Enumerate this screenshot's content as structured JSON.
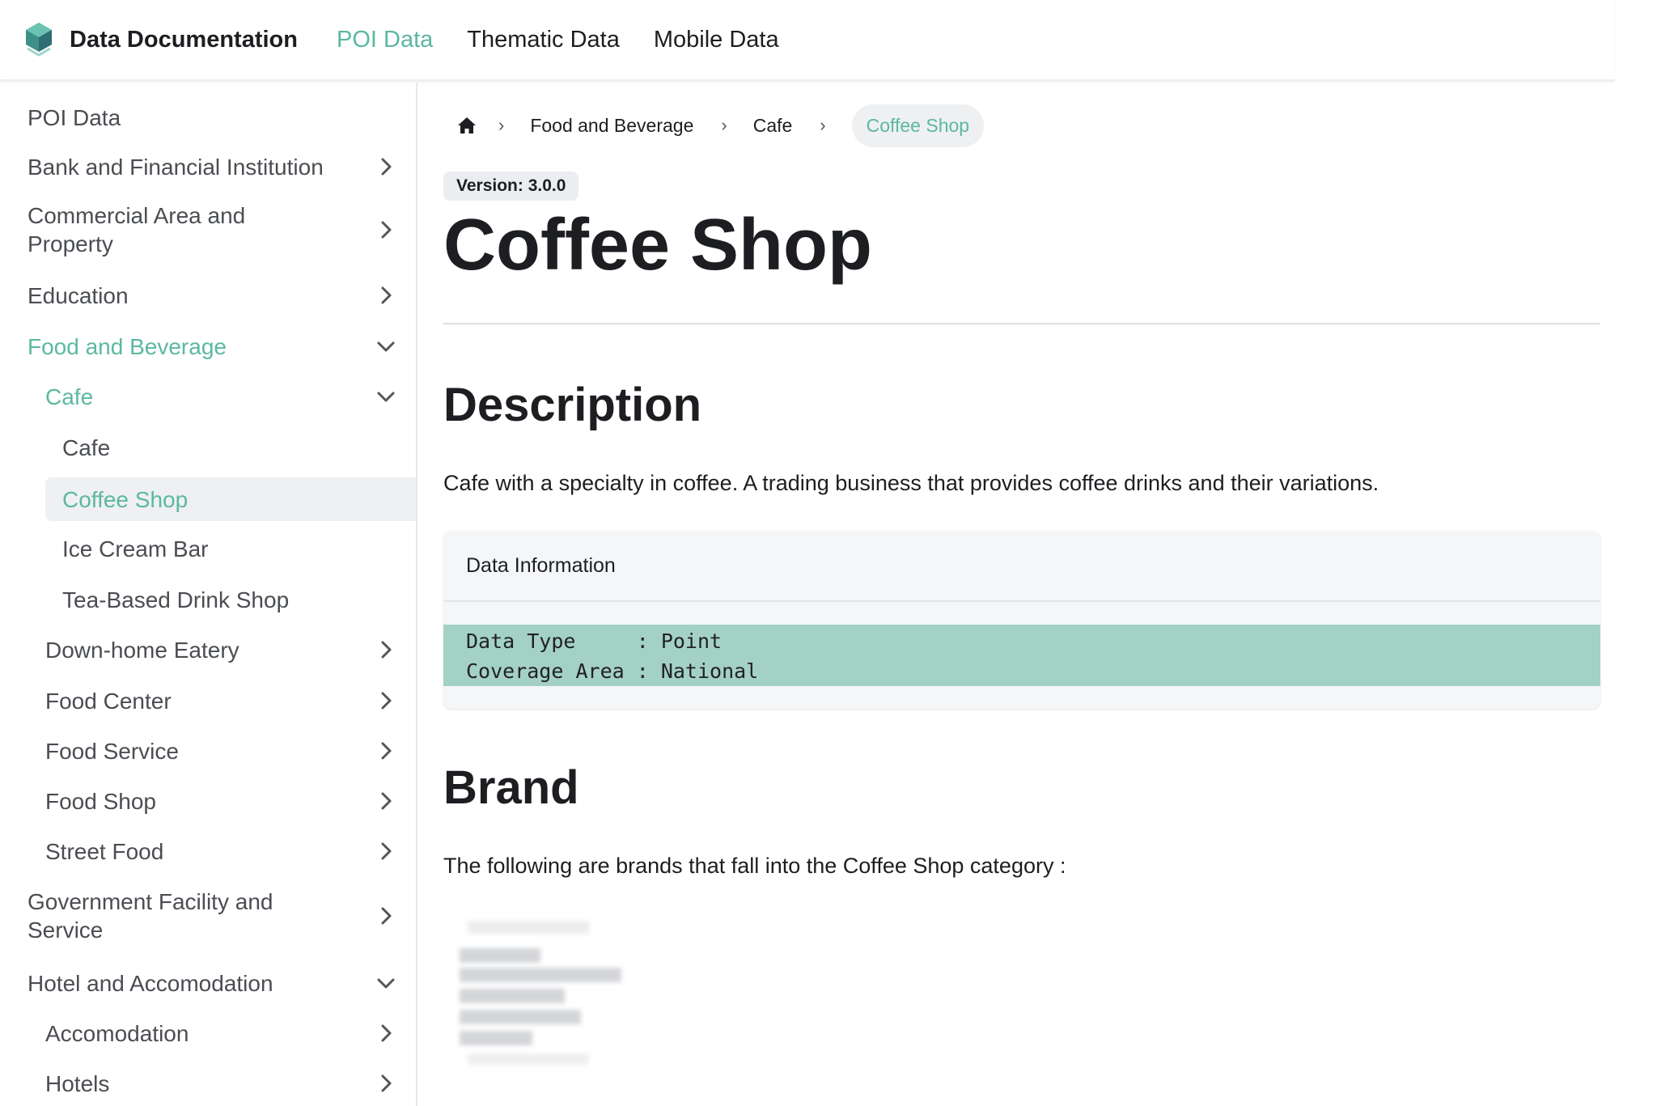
{
  "header": {
    "title": "Data Documentation",
    "nav": [
      {
        "label": "POI Data",
        "active": true
      },
      {
        "label": "Thematic Data",
        "active": false
      },
      {
        "label": "Mobile Data",
        "active": false
      }
    ]
  },
  "sidebar": {
    "items": [
      {
        "label": "POI Data",
        "chevron": "none"
      },
      {
        "label": "Bank and Financial Institution",
        "chevron": "right"
      },
      {
        "label": "Commercial Area and Property",
        "chevron": "right"
      },
      {
        "label": "Education",
        "chevron": "right"
      },
      {
        "label": "Food and Beverage",
        "chevron": "down"
      },
      {
        "label": "Cafe",
        "chevron": "down"
      },
      {
        "label": "Cafe",
        "chevron": "none"
      },
      {
        "label": "Coffee Shop",
        "chevron": "none"
      },
      {
        "label": "Ice Cream Bar",
        "chevron": "none"
      },
      {
        "label": "Tea-Based Drink Shop",
        "chevron": "none"
      },
      {
        "label": "Down-home Eatery",
        "chevron": "right"
      },
      {
        "label": "Food Center",
        "chevron": "right"
      },
      {
        "label": "Food Service",
        "chevron": "right"
      },
      {
        "label": "Food Shop",
        "chevron": "right"
      },
      {
        "label": "Street Food",
        "chevron": "right"
      },
      {
        "label": "Government Facility and Service",
        "chevron": "right"
      },
      {
        "label": "Hotel and Accomodation",
        "chevron": "down"
      },
      {
        "label": "Accomodation",
        "chevron": "right"
      },
      {
        "label": "Hotels",
        "chevron": "right"
      }
    ]
  },
  "breadcrumb": {
    "items": [
      "Food and Beverage",
      "Cafe"
    ],
    "current": "Coffee Shop"
  },
  "page": {
    "version": "Version: 3.0.0",
    "title": "Coffee Shop",
    "description_heading": "Description",
    "description_text": "Cafe with a specialty in coffee. A trading business that provides coffee drinks and their variations.",
    "info_card": {
      "header": "Data Information",
      "lines": [
        "Data Type     : Point",
        "Coverage Area : National"
      ]
    },
    "brand_heading": "Brand",
    "brand_text": "The following are brands that fall into the Coffee Shop category :"
  },
  "colors": {
    "accent": "#5cb8a0",
    "code_highlight": "#a3d1c6"
  },
  "icons": {
    "logo": "data-documentation-logo",
    "home": "home-icon",
    "chevron_right": "chevron-right-icon",
    "chevron_down": "chevron-down-icon"
  }
}
